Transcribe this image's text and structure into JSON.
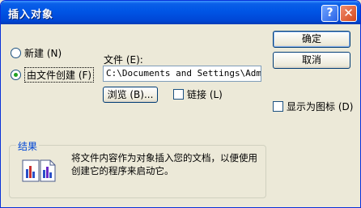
{
  "window": {
    "title": "插入对象"
  },
  "titlebar": {
    "help_glyph": "?",
    "close_glyph": "✕"
  },
  "options": {
    "create_new": "新建 (N)",
    "create_from_file": "由文件创建 (F)"
  },
  "file": {
    "label": "文件 (E):",
    "value": "C:\\Documents and Settings\\Admini"
  },
  "buttons": {
    "browse": "浏览 (B)...",
    "ok": "确定",
    "cancel": "取消"
  },
  "checkboxes": {
    "link": "链接 (L)",
    "display_as_icon": "显示为图标 (D)"
  },
  "result": {
    "title": "结果",
    "text": "将文件内容作为对象插入您的文档，以便使用创建它的程序来启动它。"
  }
}
